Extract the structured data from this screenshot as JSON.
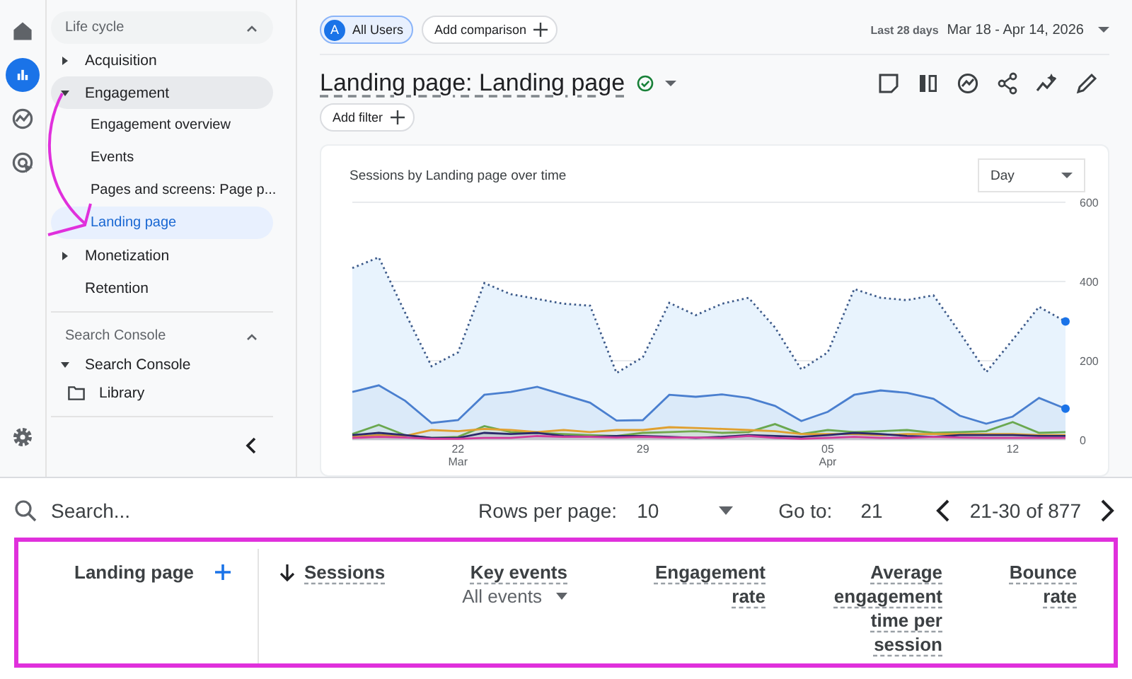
{
  "rail": {
    "items": [
      {
        "selected": false
      },
      {
        "selected": true
      },
      {
        "selected": false
      },
      {
        "selected": false
      }
    ]
  },
  "sidebar": {
    "sections": [
      {
        "title": "Life cycle",
        "expanded": true,
        "items": [
          {
            "label": "Acquisition",
            "expanded": false,
            "selected": false
          },
          {
            "label": "Engagement",
            "expanded": true,
            "selected": true,
            "children": [
              {
                "label": "Engagement overview",
                "selected": false
              },
              {
                "label": "Events",
                "selected": false
              },
              {
                "label": "Pages and screens: Page p...",
                "selected": false
              },
              {
                "label": "Landing page",
                "selected": true
              }
            ]
          },
          {
            "label": "Monetization",
            "expanded": false,
            "selected": false
          },
          {
            "label": "Retention",
            "selected": false
          }
        ]
      },
      {
        "title": "Search Console",
        "expanded": true,
        "items": [
          {
            "label": "Search Console",
            "expanded": true,
            "selected": false
          }
        ]
      }
    ],
    "library": "Library"
  },
  "toolbar": {
    "segment": {
      "avatar": "A",
      "label": "All Users"
    },
    "add_comparison": "Add comparison",
    "range_label": "Last 28 days",
    "date_range": "Mar 18 - Apr 14, 2026"
  },
  "report": {
    "title": "Landing page: Landing page",
    "add_filter": "Add filter"
  },
  "chart": {
    "title": "Sessions by Landing page over time",
    "interval": "Day",
    "chart_data": {
      "type": "area",
      "ylim": [
        0,
        600
      ],
      "yticks": [
        0,
        200,
        400,
        600
      ],
      "categories": [
        null,
        null,
        null,
        null,
        "22\nMar",
        null,
        null,
        null,
        null,
        null,
        null,
        "29",
        null,
        null,
        null,
        null,
        null,
        null,
        "05\nApr",
        null,
        null,
        null,
        null,
        null,
        null,
        "12",
        null,
        null
      ],
      "series": [
        {
          "color": "#3d5a8a",
          "line_style": "dotted",
          "values": [
            434,
            461,
            321,
            186,
            221,
            396,
            368,
            356,
            344,
            339,
            169,
            209,
            346,
            315,
            344,
            359,
            284,
            178,
            221,
            381,
            359,
            353,
            365,
            271,
            171,
            253,
            336,
            299
          ]
        },
        {
          "color": "#4a7fcf",
          "values": [
            121,
            138,
            99,
            43,
            50,
            114,
            121,
            134,
            114,
            94,
            49,
            50,
            114,
            109,
            115,
            106,
            86,
            48,
            71,
            114,
            125,
            119,
            104,
            61,
            41,
            59,
            106,
            79
          ]
        },
        {
          "color": "#6aa84f",
          "values": [
            15,
            38,
            12,
            5,
            8,
            35,
            20,
            18,
            15,
            12,
            10,
            18,
            20,
            22,
            18,
            20,
            40,
            15,
            25,
            20,
            22,
            25,
            18,
            20,
            22,
            45,
            18,
            20
          ]
        },
        {
          "color": "#e0a030",
          "values": [
            8,
            12,
            10,
            25,
            22,
            28,
            25,
            20,
            25,
            20,
            25,
            25,
            32,
            30,
            28,
            25,
            22,
            15,
            15,
            15,
            12,
            15,
            15,
            15,
            15,
            15,
            12,
            12
          ]
        },
        {
          "color": "#2b2a6b",
          "values": [
            12,
            18,
            12,
            5,
            5,
            18,
            15,
            18,
            10,
            8,
            10,
            10,
            8,
            5,
            8,
            12,
            10,
            8,
            12,
            18,
            15,
            10,
            8,
            12,
            12,
            12,
            10,
            10
          ]
        },
        {
          "color": "#d23c9c",
          "values": [
            5,
            8,
            6,
            3,
            3,
            5,
            5,
            10,
            8,
            8,
            6,
            8,
            6,
            6,
            5,
            10,
            5,
            3,
            5,
            8,
            5,
            5,
            8,
            6,
            5,
            5,
            5,
            5
          ]
        }
      ]
    }
  },
  "table_controls": {
    "search_placeholder": "Search...",
    "rows_label": "Rows per page:",
    "rows_value": "10",
    "goto_label": "Go to:",
    "goto_value": "21",
    "range": "21-30 of 877"
  },
  "table": {
    "columns": [
      {
        "label": "Landing page",
        "kind": "dimension"
      },
      {
        "label": "Sessions",
        "kind": "metric",
        "sorted": true
      },
      {
        "label": "Key events",
        "kind": "metric",
        "filter": "All events"
      },
      {
        "label": "Engagement rate",
        "kind": "metric"
      },
      {
        "label": "Average engagement time per session",
        "kind": "metric"
      },
      {
        "label": "Bounce rate",
        "kind": "metric"
      }
    ]
  },
  "annotation_arrow": {
    "color": "#e030dc"
  },
  "highlight_frame": {
    "color": "#e030dc"
  }
}
